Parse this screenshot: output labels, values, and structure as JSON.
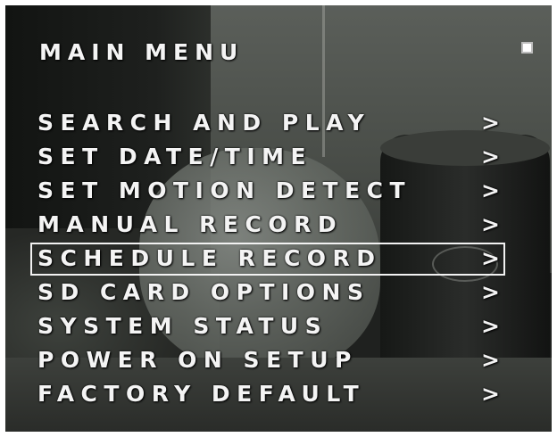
{
  "menu": {
    "title": "MAIN MENU",
    "status_indicator": "white-square-icon",
    "items": [
      {
        "label": "SEARCH AND PLAY",
        "arrow": ">"
      },
      {
        "label": "SET DATE/TIME",
        "arrow": ">"
      },
      {
        "label": "SET MOTION DETECT",
        "arrow": ">"
      },
      {
        "label": "MANUAL RECORD",
        "arrow": ">"
      },
      {
        "label": "SCHEDULE RECORD",
        "arrow": ">",
        "selected": true
      },
      {
        "label": "SD CARD OPTIONS",
        "arrow": ">"
      },
      {
        "label": "SYSTEM STATUS",
        "arrow": ">"
      },
      {
        "label": "POWER ON SETUP",
        "arrow": ">"
      },
      {
        "label": "FACTORY DEFAULT",
        "arrow": ">"
      }
    ]
  },
  "colors": {
    "text": "#f4f4f4",
    "selection_border": "#f2f2f2"
  }
}
